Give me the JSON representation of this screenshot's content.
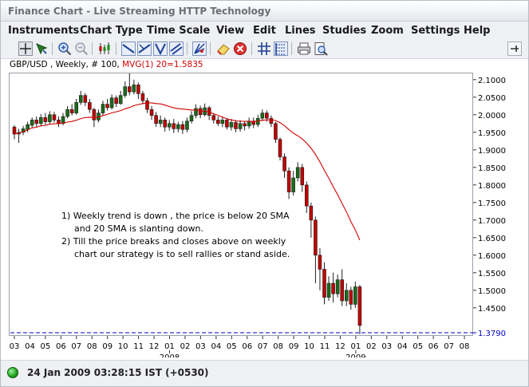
{
  "window": {
    "title": "Finance Chart - Live Streaming HTTP Technology"
  },
  "menubar": {
    "items": [
      "Instruments",
      "Chart Type",
      "Time Scale",
      "View",
      "Edit",
      "Lines",
      "Studies",
      "Zoom",
      "Settings",
      "Help"
    ]
  },
  "toolbar": {
    "icons": [
      "crosshair-icon",
      "cursor-icon",
      "zoom-in-icon",
      "zoom-out-icon",
      "candlestick-icon",
      "line-down-icon",
      "line-up-icon",
      "trend-line-icon",
      "channel-icon",
      "fan-icon",
      "eraser-icon",
      "delete-icon",
      "grid-icon",
      "fibonacci-icon",
      "print-icon",
      "print-preview-icon",
      "pin-icon"
    ]
  },
  "chart": {
    "symbol_label": "GBP/USD , Weekly, # 100, ",
    "indicator_label": "MVG(1) 20=1.5835",
    "indicator_color": "#d00000",
    "candle_up_color": "#1a6b1a",
    "candle_down_color": "#c00000",
    "current_price_label": "1.3790",
    "current_price_line_color": "#0000c8",
    "annotation": {
      "line1": "1) Weekly trend is down , the price is below 20 SMA",
      "line2": "and 20 SMA is slanting down.",
      "line3": "2) Till the price breaks and closes above on weekly",
      "line4": "chart our strategy is to sell rallies or stand aside."
    }
  },
  "chart_data": {
    "type": "candlestick",
    "title": "GBP/USD , Weekly, # 100",
    "indicator": "MVG(1) 20",
    "ylim": [
      1.37,
      2.12
    ],
    "y_ticks": [
      "2.1000",
      "2.0500",
      "2.0000",
      "1.9500",
      "1.9000",
      "1.8500",
      "1.8000",
      "1.7500",
      "1.7000",
      "1.6500",
      "1.6000",
      "1.5500",
      "1.5000",
      "1.4500"
    ],
    "y_tick_values": [
      2.1,
      2.05,
      2.0,
      1.95,
      1.9,
      1.85,
      1.8,
      1.75,
      1.7,
      1.65,
      1.6,
      1.55,
      1.5,
      1.45
    ],
    "x_ticks": [
      "03",
      "04",
      "05",
      "06",
      "07",
      "08",
      "09",
      "10",
      "11",
      "12",
      "01",
      "02",
      "03",
      "04",
      "05",
      "06",
      "07",
      "08",
      "09",
      "10",
      "11",
      "12",
      "01",
      "02",
      "03",
      "04",
      "05",
      "06",
      "07",
      "08"
    ],
    "x_year_labels": [
      {
        "label": "2008",
        "at_tick": 10
      },
      {
        "label": "2009",
        "at_tick": 22
      }
    ],
    "current_price": 1.379,
    "candles": [
      [
        1.965,
        1.945,
        1.97,
        1.93
      ],
      [
        1.945,
        1.95,
        1.96,
        1.92
      ],
      [
        1.95,
        1.96,
        1.968,
        1.942
      ],
      [
        1.958,
        1.972,
        1.98,
        1.95
      ],
      [
        1.97,
        1.985,
        1.992,
        1.962
      ],
      [
        1.985,
        1.975,
        1.995,
        1.965
      ],
      [
        1.975,
        1.992,
        2.002,
        1.968
      ],
      [
        1.992,
        1.98,
        2.005,
        1.972
      ],
      [
        1.98,
        2.0,
        2.01,
        1.975
      ],
      [
        2.0,
        1.985,
        2.008,
        1.978
      ],
      [
        1.985,
        1.975,
        1.995,
        1.965
      ],
      [
        1.975,
        1.995,
        2.005,
        1.97
      ],
      [
        1.995,
        2.015,
        2.025,
        1.99
      ],
      [
        2.015,
        2.005,
        2.03,
        1.998
      ],
      [
        2.005,
        2.035,
        2.045,
        2.0
      ],
      [
        2.035,
        2.055,
        2.068,
        2.028
      ],
      [
        2.055,
        2.035,
        2.062,
        2.025
      ],
      [
        2.035,
        2.015,
        2.045,
        2.005
      ],
      [
        2.015,
        1.985,
        2.02,
        1.965
      ],
      [
        1.985,
        2.005,
        2.015,
        1.978
      ],
      [
        2.005,
        2.03,
        2.04,
        1.998
      ],
      [
        2.03,
        2.02,
        2.045,
        2.012
      ],
      [
        2.02,
        2.048,
        2.058,
        2.015
      ],
      [
        2.048,
        2.032,
        2.055,
        2.022
      ],
      [
        2.032,
        2.055,
        2.068,
        2.028
      ],
      [
        2.055,
        2.08,
        2.095,
        2.048
      ],
      [
        2.08,
        2.065,
        2.118,
        2.055
      ],
      [
        2.065,
        2.085,
        2.1,
        2.058
      ],
      [
        2.085,
        2.06,
        2.092,
        2.045
      ],
      [
        2.06,
        2.04,
        2.068,
        2.03
      ],
      [
        2.04,
        2.015,
        2.048,
        2.005
      ],
      [
        2.015,
        1.998,
        2.025,
        1.985
      ],
      [
        1.998,
        1.975,
        2.008,
        1.965
      ],
      [
        1.975,
        1.985,
        1.998,
        1.965
      ],
      [
        1.985,
        1.965,
        1.992,
        1.952
      ],
      [
        1.965,
        1.975,
        1.985,
        1.955
      ],
      [
        1.975,
        1.96,
        1.988,
        1.948
      ],
      [
        1.96,
        1.972,
        1.98,
        1.95
      ],
      [
        1.972,
        1.958,
        1.982,
        1.945
      ],
      [
        1.958,
        1.982,
        1.992,
        1.95
      ],
      [
        1.982,
        1.998,
        2.01,
        1.975
      ],
      [
        1.998,
        2.018,
        2.03,
        1.99
      ],
      [
        2.018,
        2.0,
        2.026,
        1.99
      ],
      [
        2.0,
        2.02,
        2.032,
        1.995
      ],
      [
        2.02,
        1.998,
        2.025,
        1.985
      ],
      [
        1.998,
        1.985,
        2.005,
        1.975
      ],
      [
        1.985,
        1.975,
        1.995,
        1.968
      ],
      [
        1.975,
        1.985,
        1.995,
        1.965
      ],
      [
        1.985,
        1.965,
        1.99,
        1.958
      ],
      [
        1.965,
        1.978,
        1.988,
        1.955
      ],
      [
        1.978,
        1.96,
        1.985,
        1.95
      ],
      [
        1.96,
        1.975,
        1.985,
        1.952
      ],
      [
        1.975,
        1.968,
        1.982,
        1.955
      ],
      [
        1.968,
        1.982,
        1.992,
        1.96
      ],
      [
        1.982,
        1.972,
        1.992,
        1.962
      ],
      [
        1.972,
        1.99,
        2.0,
        1.965
      ],
      [
        1.99,
        2.005,
        2.015,
        1.982
      ],
      [
        2.005,
        1.99,
        2.012,
        1.98
      ],
      [
        1.99,
        1.975,
        1.998,
        1.965
      ],
      [
        1.975,
        1.93,
        1.98,
        1.92
      ],
      [
        1.93,
        1.88,
        1.935,
        1.87
      ],
      [
        1.88,
        1.84,
        1.89,
        1.82
      ],
      [
        1.84,
        1.78,
        1.85,
        1.76
      ],
      [
        1.78,
        1.82,
        1.84,
        1.77
      ],
      [
        1.82,
        1.85,
        1.865,
        1.81
      ],
      [
        1.85,
        1.8,
        1.86,
        1.78
      ],
      [
        1.8,
        1.74,
        1.81,
        1.72
      ],
      [
        1.74,
        1.7,
        1.75,
        1.65
      ],
      [
        1.7,
        1.6,
        1.71,
        1.52
      ],
      [
        1.6,
        1.56,
        1.62,
        1.5
      ],
      [
        1.56,
        1.48,
        1.58,
        1.46
      ],
      [
        1.48,
        1.52,
        1.54,
        1.47
      ],
      [
        1.52,
        1.49,
        1.55,
        1.465
      ],
      [
        1.49,
        1.53,
        1.545,
        1.48
      ],
      [
        1.53,
        1.47,
        1.56,
        1.455
      ],
      [
        1.47,
        1.5,
        1.52,
        1.455
      ],
      [
        1.5,
        1.46,
        1.51,
        1.445
      ],
      [
        1.46,
        1.51,
        1.525,
        1.45
      ],
      [
        1.51,
        1.4,
        1.515,
        1.375
      ]
    ]
  },
  "status": {
    "timestamp": "24 Jan 2009 03:28:15  IST (+0530)",
    "connection_color": "#1ea01e"
  }
}
